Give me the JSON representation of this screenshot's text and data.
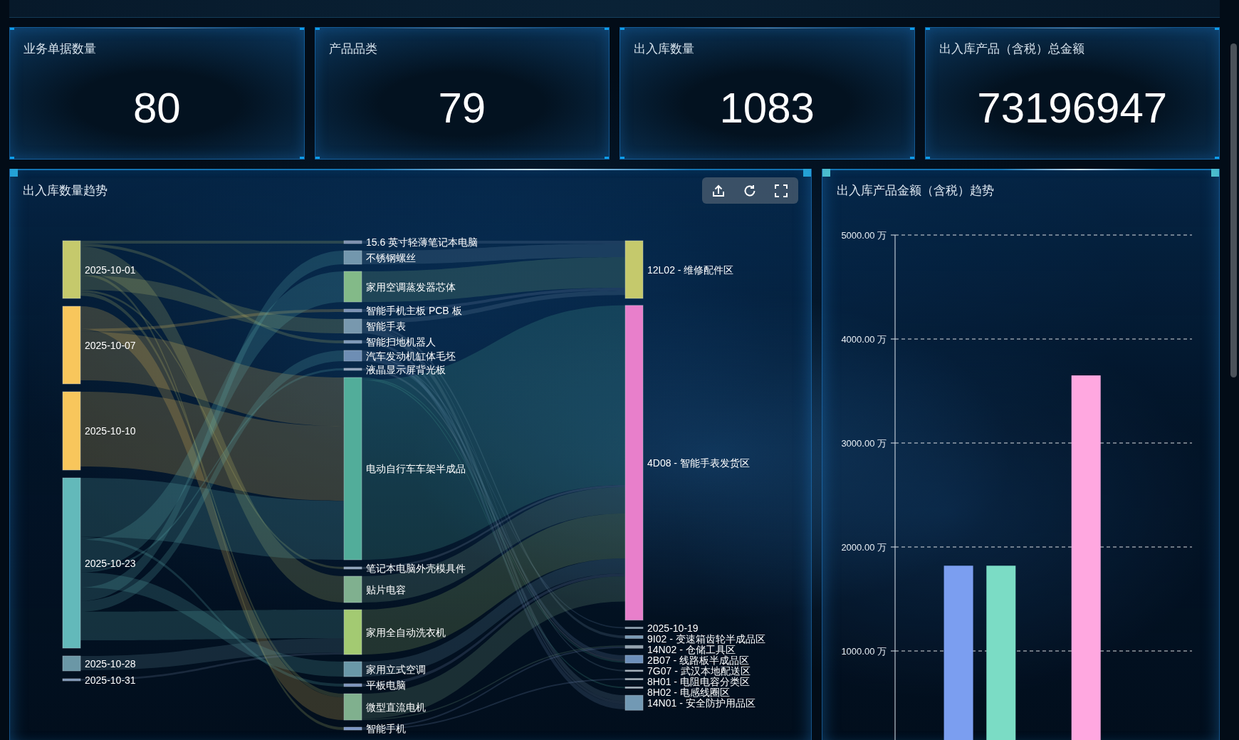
{
  "stats": [
    {
      "label": "业务单据数量",
      "value": "80"
    },
    {
      "label": "产品品类",
      "value": "79"
    },
    {
      "label": "出入库数量",
      "value": "1083"
    },
    {
      "label": "出入库产品（含税）总金额",
      "value": "73196947"
    }
  ],
  "quantity_panel": {
    "title": "出入库数量趋势",
    "sankey": {
      "columns": [
        {
          "nodes": [
            {
              "label": "2025-10-01",
              "color": "#c5c96c"
            },
            {
              "label": "2025-10-07",
              "color": "#f8c65c"
            },
            {
              "label": "2025-10-10",
              "color": "#f8c65c"
            },
            {
              "label": "2025-10-23",
              "color": "#63b9ba"
            },
            {
              "label": "2025-10-28",
              "color": "#6b97a6"
            },
            {
              "label": "2025-10-31",
              "color": "#7b93b4"
            }
          ]
        },
        {
          "nodes": [
            {
              "label": "15.6 英寸轻薄笔记本电脑",
              "color": "#7d8fae"
            },
            {
              "label": "不锈钢螺丝",
              "color": "#7397ad"
            },
            {
              "label": "家用空调蒸发器芯体",
              "color": "#83ba88"
            },
            {
              "label": "智能手机主板 PCB 板",
              "color": "#7b91b4"
            },
            {
              "label": "智能手表",
              "color": "#7898ae"
            },
            {
              "label": "智能扫地机器人",
              "color": "#7d98b8"
            },
            {
              "label": "汽车发动机缸体毛坯",
              "color": "#6e8eb4"
            },
            {
              "label": "液晶显示屏背光板",
              "color": "#8fa2ba"
            },
            {
              "label": "电动自行车车架半成品",
              "color": "#52ad9a"
            },
            {
              "label": "笔记本电脑外壳模具件",
              "color": "#8ea0b8"
            },
            {
              "label": "贴片电容",
              "color": "#80b08f"
            },
            {
              "label": "家用全自动洗衣机",
              "color": "#a3ca72"
            },
            {
              "label": "家用立式空调",
              "color": "#6a98a8"
            },
            {
              "label": "平板电脑",
              "color": "#7b92bb"
            },
            {
              "label": "微型直流电机",
              "color": "#80b08e"
            },
            {
              "label": "智能手机",
              "color": "#7b95c4"
            }
          ]
        },
        {
          "nodes": [
            {
              "label": "12L02 - 维修配件区",
              "color": "#c5c96c"
            },
            {
              "label": "4D08 - 智能手表发货区",
              "color": "#e87fcb"
            },
            {
              "label": "2025-10-19",
              "color": "#8fa3b3"
            },
            {
              "label": "9I02 - 变速箱齿轮半成品区",
              "color": "#7a9bb6"
            },
            {
              "label": "14N02 - 仓储工具区",
              "color": "#95a3b0"
            },
            {
              "label": "2B07 - 线路板半成品区",
              "color": "#6d8fba"
            },
            {
              "label": "7G07 - 武汉本地配送区",
              "color": "#a9b3bd"
            },
            {
              "label": "8H01 - 电阻电容分类区",
              "color": "#a9b3bd"
            },
            {
              "label": "8H02 - 电感线圈区",
              "color": "#a9b3bd"
            },
            {
              "label": "14N01 - 安全防护用品区",
              "color": "#7299b4"
            }
          ]
        }
      ]
    }
  },
  "amount_panel": {
    "title": "出入库产品金额（含税）趋势",
    "chart_data": {
      "type": "bar",
      "stacked": false,
      "grid": true,
      "ylim": [
        0,
        5000
      ],
      "yticks": [
        {
          "value": 1000,
          "label": "1000.00 万"
        },
        {
          "value": 2000,
          "label": "2000.00 万"
        },
        {
          "value": 3000,
          "label": "3000.00 万"
        },
        {
          "value": 4000,
          "label": "4000.00 万"
        },
        {
          "value": 5000,
          "label": "5000.00 万"
        }
      ],
      "series": [
        {
          "color": "#7b9ef0",
          "values": [
            1820
          ]
        },
        {
          "color": "#7bdcc5",
          "values": [
            1820
          ]
        },
        {
          "color": "#ffa8e0",
          "values": [
            3650
          ]
        }
      ]
    }
  }
}
